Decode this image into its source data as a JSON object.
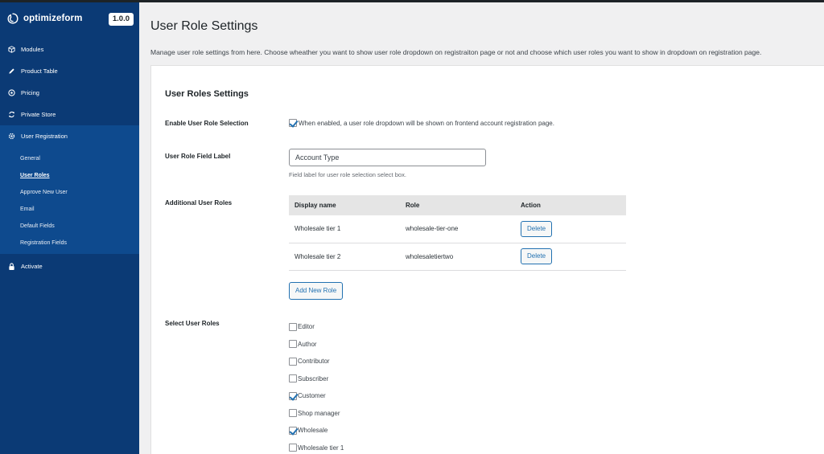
{
  "brand": {
    "name": "optimizeform",
    "version": "1.0.0"
  },
  "nav": {
    "modules": "Modules",
    "product_table": "Product Table",
    "pricing": "Pricing",
    "private_store": "Private Store",
    "user_registration": "User Registration",
    "activate": "Activate"
  },
  "subnav": [
    "General",
    "User Roles",
    "Approve New User",
    "Email",
    "Default Fields",
    "Registration Fields"
  ],
  "page": {
    "title": "User Role Settings",
    "description": "Manage user role settings from here. Choose wheather you want to show user role dropdown on registraiton page or not and choose which user roles you want to show in dropdown on registration page."
  },
  "settings": {
    "section_title": "User Roles Settings",
    "enable_label": "Enable User Role Selection",
    "enable_checked": true,
    "enable_desc": "When enabled, a user role dropdown will be shown on frontend account registration page.",
    "field_label_label": "User Role Field Label",
    "field_label_value": "Account Type",
    "field_label_help": "Field label for user role selection select box.",
    "additional_label": "Additional User Roles",
    "table_headers": {
      "display_name": "Display name",
      "role": "Role",
      "action": "Action"
    },
    "roles": [
      {
        "display_name": "Wholesale tier 1",
        "role": "wholesale-tier-one",
        "action": "Delete"
      },
      {
        "display_name": "Wholesale tier 2",
        "role": "wholesaletiertwo",
        "action": "Delete"
      }
    ],
    "add_button": "Add New Role",
    "select_label": "Select User Roles",
    "user_roles": [
      {
        "label": "Editor",
        "checked": false
      },
      {
        "label": "Author",
        "checked": false
      },
      {
        "label": "Contributor",
        "checked": false
      },
      {
        "label": "Subscriber",
        "checked": false
      },
      {
        "label": "Customer",
        "checked": true
      },
      {
        "label": "Shop manager",
        "checked": false
      },
      {
        "label": "Wholesale",
        "checked": true
      },
      {
        "label": "Wholesale tier 1",
        "checked": false
      }
    ]
  },
  "colors": {
    "sidebar": "#0b3a75",
    "sidebar_active": "#0e4a8e",
    "accent": "#2271b1"
  }
}
